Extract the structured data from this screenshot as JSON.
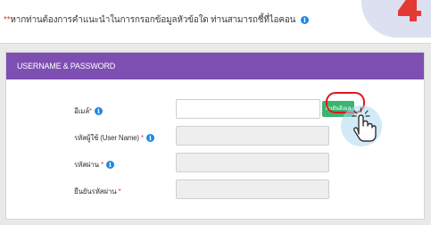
{
  "hint": {
    "star": "**",
    "text": "หากท่านต้องการคำแนะนำในการกรอกข้อมูลหัวข้อใด ท่านสามารถชี้ที่ไอคอน",
    "info_glyph": "i"
  },
  "step_badge": {
    "number": "4",
    "color": "#e53935"
  },
  "panel": {
    "header": "USERNAME & PASSWORD",
    "header_color": "#7e4fb3",
    "fields": [
      {
        "label": "อีเมล์",
        "required": "*",
        "has_info": true,
        "value": ""
      },
      {
        "label": "รหัสผู้ใช้ (User Name)",
        "required": "*",
        "has_info": true,
        "value": ""
      },
      {
        "label": "รหัสผ่าน",
        "required": "*",
        "has_info": true,
        "value": ""
      },
      {
        "label": "ยืนยันรหัสผ่าน",
        "required": "*",
        "has_info": false,
        "value": ""
      }
    ],
    "check_button": "ยืนยันอีเมล",
    "check_button_color": "#3cb371"
  },
  "icons": {
    "info": "info-icon",
    "cursor": "pointer-hand-icon",
    "highlight": "red-ring"
  }
}
